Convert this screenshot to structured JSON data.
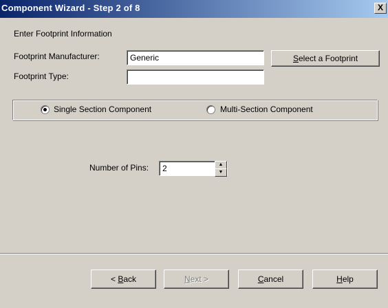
{
  "window": {
    "title": "Component Wizard - Step 2 of 8",
    "close_label": "X"
  },
  "section": {
    "heading": "Enter Footprint Information"
  },
  "footprint": {
    "manufacturer_label": "Footprint Manufacturer:",
    "manufacturer_value": "Generic",
    "type_label": "Footprint Type:",
    "type_value": "",
    "select_button": {
      "mnemonic": "S",
      "rest": "elect a Footprint"
    }
  },
  "component_type": {
    "options": [
      {
        "label": "Single Section Component",
        "selected": true
      },
      {
        "label": "Multi-Section Component",
        "selected": false
      }
    ]
  },
  "pins": {
    "label": "Number of Pins:",
    "value": "2",
    "up_icon": "spin-up-arrow",
    "down_icon": "spin-down-arrow"
  },
  "buttons": {
    "back": {
      "prefix": "< ",
      "mnemonic": "B",
      "rest": "ack",
      "enabled": true
    },
    "next": {
      "mnemonic": "N",
      "rest": "ext >",
      "enabled": false
    },
    "cancel": {
      "mnemonic": "C",
      "rest": "ancel",
      "enabled": true
    },
    "help": {
      "mnemonic": "H",
      "rest": "elp",
      "enabled": true
    }
  },
  "colors": {
    "titlebar_start": "#0a246a",
    "titlebar_end": "#a6caf0",
    "face": "#d4d0c8"
  }
}
